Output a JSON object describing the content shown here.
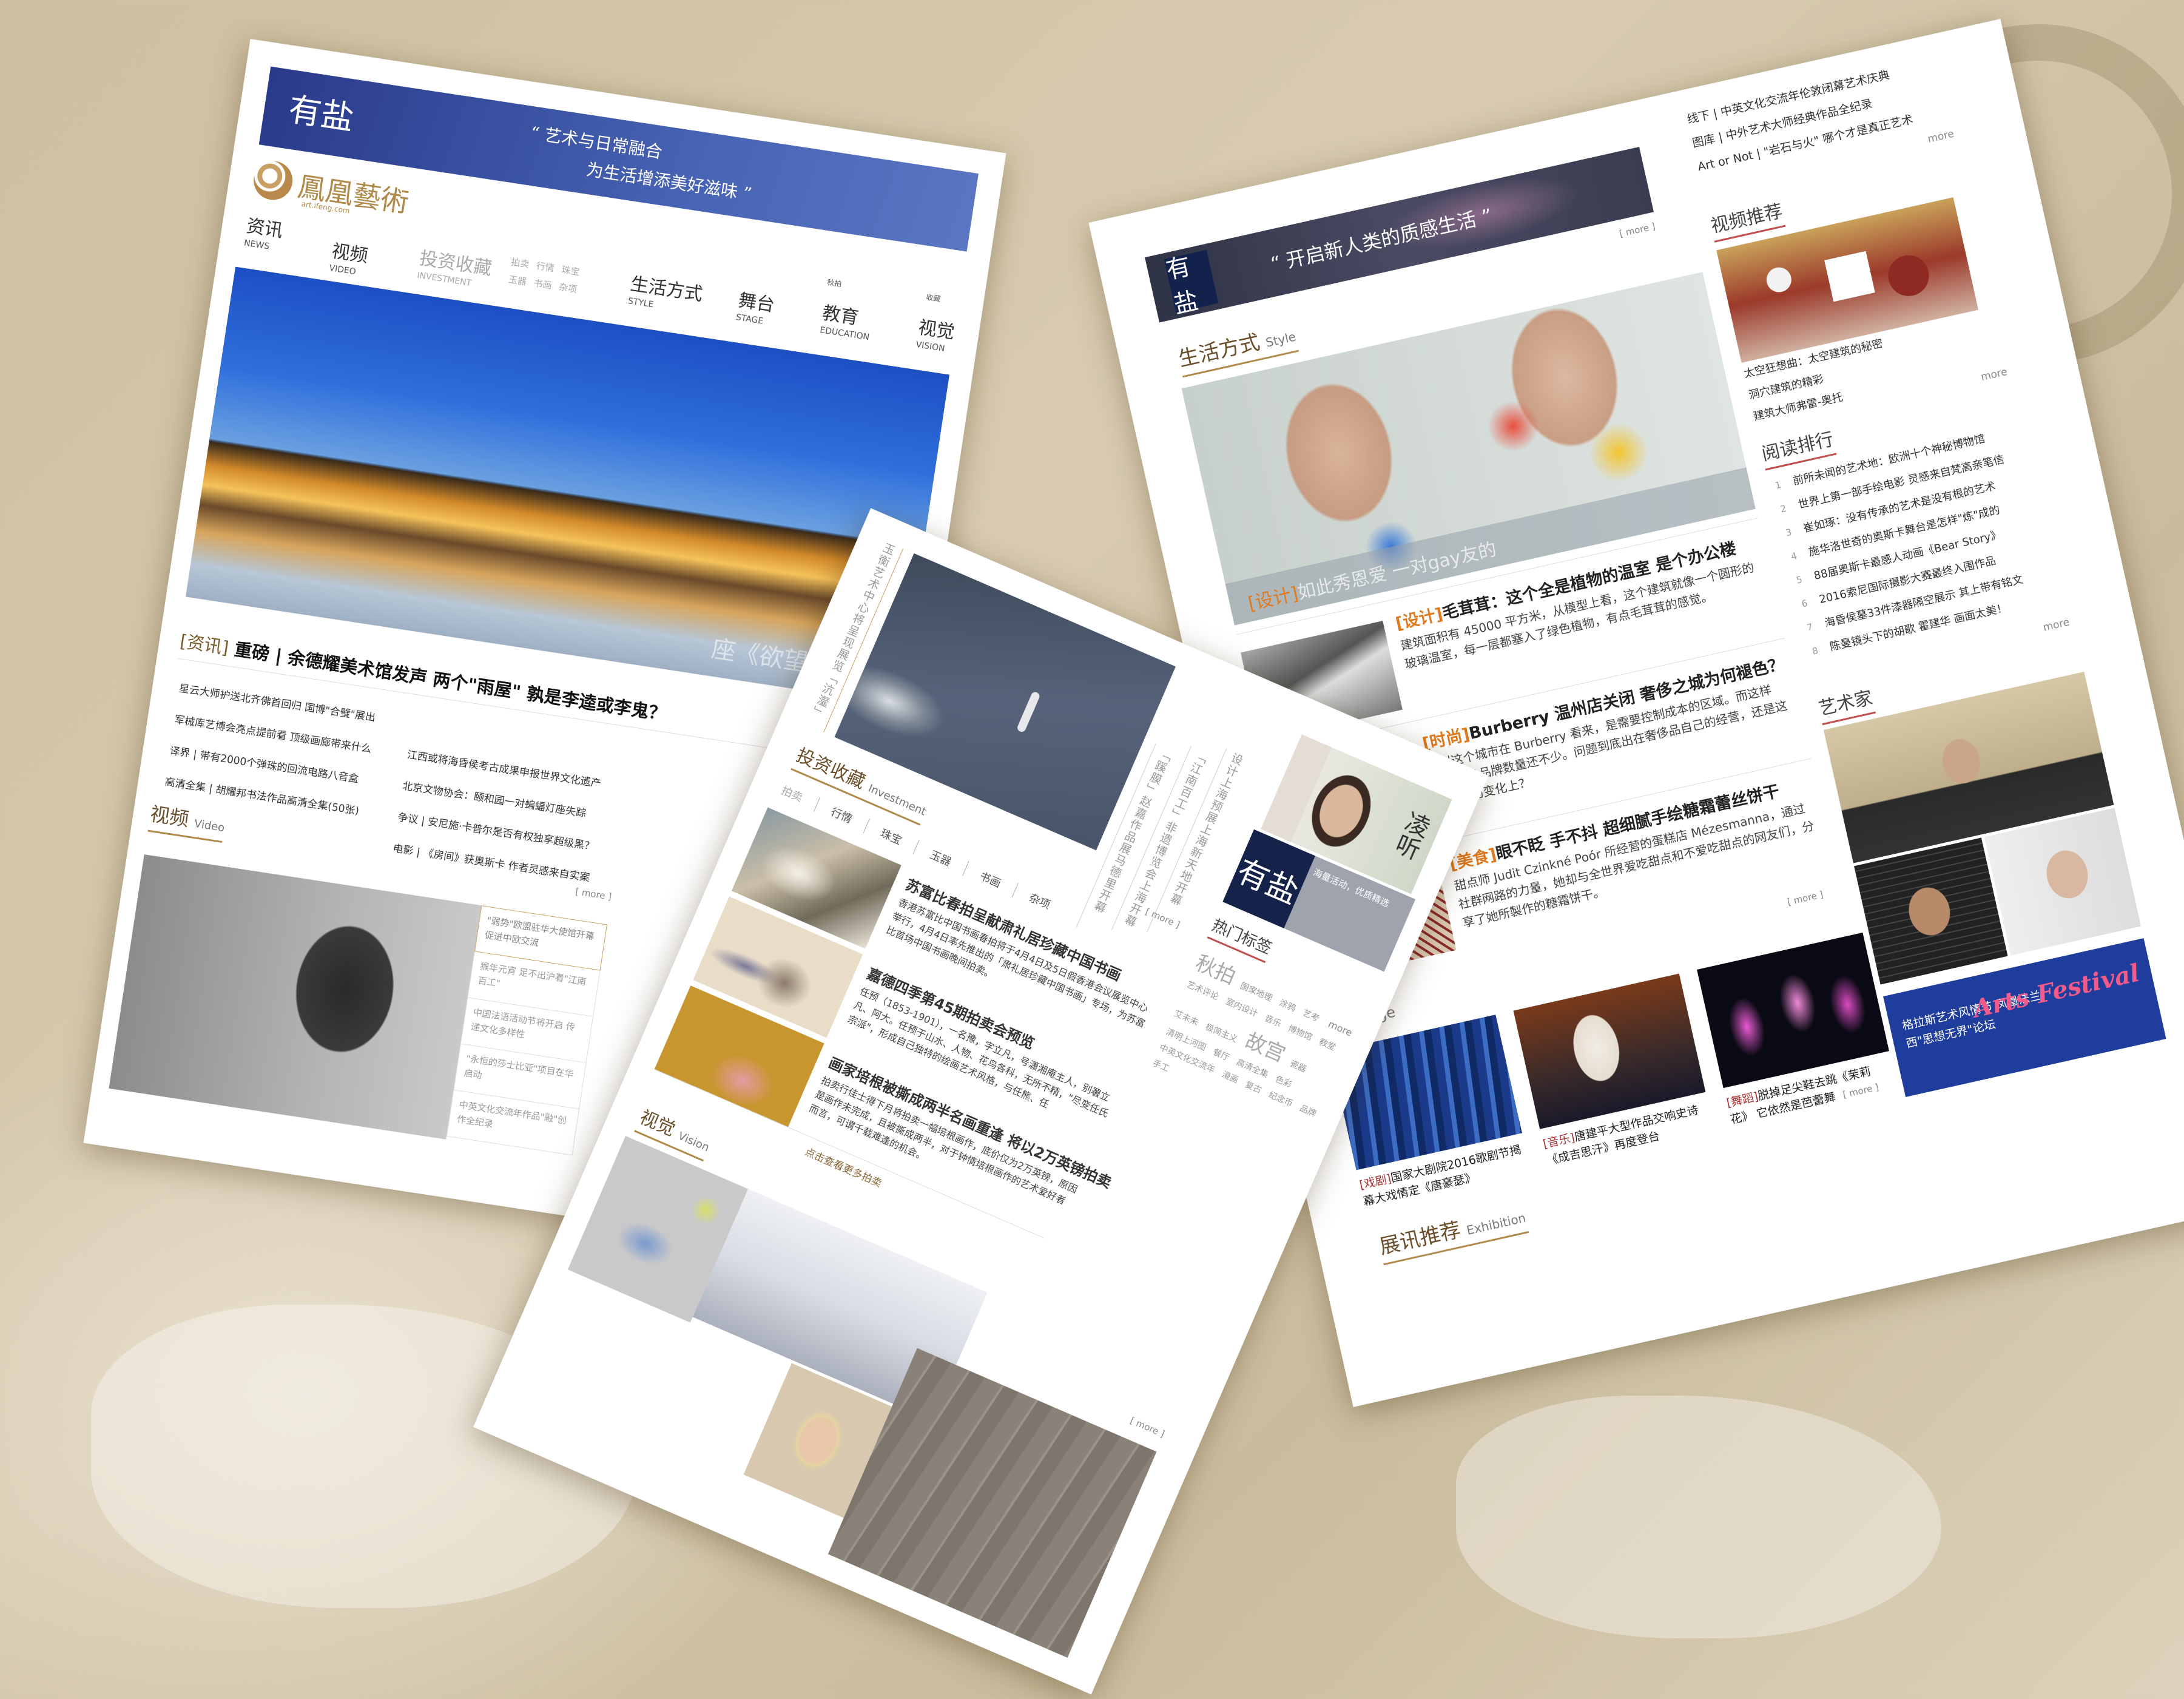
{
  "left_page": {
    "banner": {
      "logo": "有盐",
      "quote_line1": "“ 艺术与日常融合",
      "quote_line2": "为生活增添美好滋味 ”"
    },
    "brand": {
      "name": "鳳凰藝術",
      "url": "art.ifeng.com"
    },
    "nav": [
      {
        "zh": "资讯",
        "en": "NEWS"
      },
      {
        "zh": "视频",
        "en": "VIDEO"
      },
      {
        "zh": "投资收藏",
        "en": "INVESTMENT"
      },
      {
        "zh": "生活方式",
        "en": "STYLE"
      },
      {
        "zh": "舞台",
        "en": "STAGE"
      },
      {
        "zh": "教育",
        "en": "EDUCATION"
      },
      {
        "zh": "视觉",
        "en": "VISION"
      }
    ],
    "subnav": [
      "拍卖",
      "行情",
      "珠宝",
      "玉器",
      "书画",
      "杂项"
    ],
    "nav_extra": [
      "秋拍",
      "收藏"
    ],
    "hero_caption": "座《欲望都市》",
    "headline": {
      "category": "[资讯]",
      "text": " 重磅 | 余德耀美术馆发声 两个\"雨屋\" 孰是李逵或李鬼？"
    },
    "news_left": [
      "星云大师护送北齐佛首回归 国博\"合璧\"展出",
      "军械库艺博会亮点提前看 顶级画廊带来什么",
      "译界 | 带有2000个弹珠的回流电路八音盒",
      "高清全集 | 胡耀邦书法作品高清全集(50张)"
    ],
    "news_right": [
      "江西或将海昏侯考古成果申报世界文化遗产",
      "北京文物协会：颐和园一对蝙蝠灯座失踪",
      "争议 | 安尼施·卡普尔是否有权独享超级黑？",
      "电影 | 《房间》获奥斯卡 作者灵感来自实案"
    ],
    "video": {
      "title": "视频",
      "title_en": "Video",
      "more": "[ more ]",
      "list": [
        "\"弱势\"欧盟驻华大使馆开幕促进中欧交流",
        "猴年元宵 足不出沪看\"江南百工\"",
        "中国法语活动节将开启 传递文化多样性",
        "\"永恒的莎士比亚\"项目在华启动",
        "中英文化交流年作品\"融\"创作全纪录"
      ]
    }
  },
  "middle_page": {
    "vertical_notes": [
      "玉衡艺术中心将呈现展览「沆瀣」",
      "「蹊膜」赵嘉作品展马德里开幕",
      "「江南百工」非遗博览会上海开幕",
      "设计上海预展上海新天地开幕"
    ],
    "investment": {
      "title": "投资收藏",
      "title_en": "Investment",
      "more": "[ more ]",
      "tabs": [
        "拍卖",
        "行情",
        "珠宝",
        "玉器",
        "书画",
        "杂项"
      ],
      "articles": [
        {
          "title": "苏富比春拍呈献肃礼居珍藏中国书画",
          "body": "香港苏富比中国书画春拍将于4月4日及5日假香港会议展览中心举行，4月4日率先推出的「肃礼居珍藏中国书画」专场，为苏富比首场中国书画晚间拍卖。"
        },
        {
          "title": "嘉德四季第45期拍卖会预览",
          "body": "任预（1853-1901），一名豫，字立凡，号潇湘庵主人，别署立凡、阿大。任预于山水、人物、花鸟各科，无所不精，\"尽变任氏宗派\"，形成自己独特的绘画艺术风格，与任熊、任"
        },
        {
          "title": "画家培根被撕成两半名画重逢 将以2万英镑拍卖",
          "body": "拍卖行佳士得下月将拍卖一幅培根画作，底价仅为2万英镑，原因是画作未完成，且被撕成两半，对于钟情培根画作的艺术爱好者而言，可谓千载难逢的机会。"
        }
      ],
      "more_link": "点击查看更多拍卖"
    },
    "vision": {
      "title": "视觉",
      "title_en": "Vision",
      "more": "[ more ]"
    },
    "side": {
      "calligraphy": "凌听",
      "ad_logo": "有盐",
      "ad_text": "海量活动，优质精选",
      "hot_tags_title": "热门标签",
      "more": "more",
      "featured_tags": [
        "秋拍",
        "故宫"
      ],
      "tags": [
        "国家地理",
        "涂鸦",
        "艺考",
        "艺术评论",
        "室内设计",
        "音乐",
        "博物馆",
        "教堂",
        "艾未未",
        "极简主义",
        "瓷器",
        "清明上河图",
        "餐厅",
        "高清全集",
        "色彩",
        "中英文化交流年",
        "漫画",
        "复古",
        "纪念币",
        "品牌",
        "手工"
      ]
    }
  },
  "right_page": {
    "banner": {
      "logo": "有盐",
      "quote": "“ 开启新人类的质感生活 ”",
      "more": "[ more ]"
    },
    "style": {
      "title": "生活方式",
      "title_en": "Style",
      "image_caption_cat": "[设计]",
      "image_caption": "如此秀恩爱 一对gay友的"
    },
    "articles": [
      {
        "category": "[设计]",
        "title": "毛茸茸：这个全是植物的温室 是个办公楼",
        "body": "建筑面积有 45000 平方米，从模型上看，这个建筑就像一个圆形的玻璃温室，每一层都塞入了绿色植物，有点毛茸茸的感觉。"
      },
      {
        "category": "[时尚]",
        "title": "Burberry 温州店关闭 奢侈之城为何褪色？",
        "body": "温州这个城市在 Burberry 看来，是需要控制成本的区域。而这样的奢侈品品牌数量还不少。问题到底出在奢侈品自己的经营，还是这个市场的变化上？"
      },
      {
        "category": "[美食]",
        "title": "眼不眨 手不抖 超细腻手绘糖霜蕾丝饼干",
        "body": "甜点师 Judit Czinkné Poór 所经营的蛋糕店 Mézesmanna，通过社群网路的力量，她却与全世界爱吃甜点和不爱吃甜点的网友们，分享了她所製作的糖霜饼干。"
      }
    ],
    "articles_more": "[ more ]",
    "stage": {
      "title_en": "Stage",
      "more": "[ more ]",
      "items": [
        {
          "category": "[戏剧]",
          "text": "国家大剧院2016歌剧节揭幕大戏情定《唐豪瑟》"
        },
        {
          "category": "[音乐]",
          "text": "唐建平大型作品交响史诗《成吉思汗》再度登台"
        },
        {
          "category": "[舞蹈]",
          "text": "脱掉足尖鞋去跳《茉莉花》 它依然是芭蕾舞"
        }
      ]
    },
    "exhibition": {
      "title": "展讯推荐",
      "title_en": "Exhibition"
    },
    "top_links": [
      "线下 | 中英文化交流年伦敦闭幕艺术庆典",
      "图库 | 中外艺术大师经典作品全纪录",
      "Art or Not | \"岩石与火\" 哪个才是真正艺术"
    ],
    "top_more": "more",
    "video_rec": {
      "title": "视频推荐",
      "links": [
        "太空狂想曲：太空建筑的秘密",
        "洞穴建筑的精彩",
        "建筑大师弗雷-奥托"
      ],
      "more": "more"
    },
    "ranking": {
      "title": "阅读排行",
      "more": "more",
      "items": [
        {
          "rank": "1",
          "title": "前所未闻的艺术地：欧洲十个神秘博物馆"
        },
        {
          "rank": "2",
          "title": "世界上第一部手绘电影 灵感来自梵高亲笔信"
        },
        {
          "rank": "3",
          "title": "崔如琢：没有传承的艺术是没有根的艺术"
        },
        {
          "rank": "4",
          "title": "施华洛世奇的奥斯卡舞台是怎样\"炼\"成的"
        },
        {
          "rank": "5",
          "title": "88届奥斯卡最感人动画《Bear Story》"
        },
        {
          "rank": "6",
          "title": "2016索尼国际摄影大赛最终入围作品"
        },
        {
          "rank": "7",
          "title": "海昏侯墓33件漆器隔空展示 其上带有铭文"
        },
        {
          "rank": "8",
          "title": "陈曼镜头下的胡歌 霍建华 画面太美！"
        }
      ]
    },
    "artists": {
      "title": "艺术家"
    },
    "festival": {
      "title": "格拉斯艺术风情节 凤凰法兰西\"思想无界\"论坛",
      "logo_text": "Arts Festival"
    }
  }
}
